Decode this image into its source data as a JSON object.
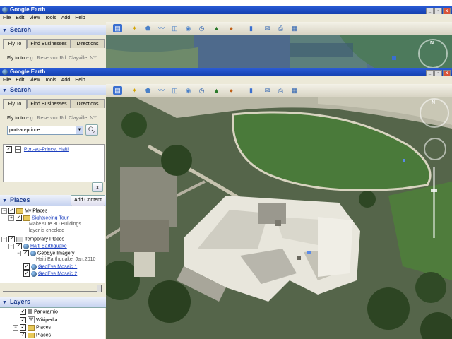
{
  "app": {
    "title": "Google Earth"
  },
  "menu": [
    "File",
    "Edit",
    "View",
    "Tools",
    "Add",
    "Help"
  ],
  "window_buttons": {
    "minimize": "_",
    "restore": "▫",
    "close": "x"
  },
  "search": {
    "header": "Search",
    "tabs": [
      "Fly To",
      "Find Businesses",
      "Directions"
    ],
    "fly_to_label": "Fly to",
    "fly_to_hint": "e.g., Reservoir Rd. Clayville, NY",
    "query": "port-au-prince",
    "result": "Port-au-Prince, Haiti",
    "clear_label": "x"
  },
  "places": {
    "header": "Places",
    "add_content": "Add Content",
    "my_places": "My Places",
    "sightseeing_tour": "Sightseeing Tour",
    "sightseeing_note_1": "Make sure 3D Buildings",
    "sightseeing_note_2": "layer is checked",
    "temporary_places": "Temporary Places",
    "haiti_earthquake": "Haiti Earthquake",
    "geoeye_imagery": "GeoEye Imagery",
    "geoeye_imagery_note": "Haiti Earthquake, Jan.2010",
    "mosaic_1": "GeoEye Mosaic 1",
    "mosaic_2": "GeoEye Mosaic 2"
  },
  "layers": {
    "header": "Layers",
    "items": [
      "Panoramio",
      "Wikipedia",
      "Places",
      "Places"
    ]
  },
  "toolbar_icons": [
    "sidebar-toggle-icon",
    "placemark-icon",
    "polygon-icon",
    "path-icon",
    "image-overlay-icon",
    "record-tour-icon",
    "historical-imagery-icon",
    "sunlight-icon",
    "planets-icon",
    "ruler-icon",
    "email-icon",
    "print-icon",
    "view-in-maps-icon"
  ],
  "colors": {
    "titlebar": "#1541b0",
    "panel_header_text": "#1f3f8f",
    "link": "#1c3fbf",
    "lawn": "#4a7a3a"
  }
}
